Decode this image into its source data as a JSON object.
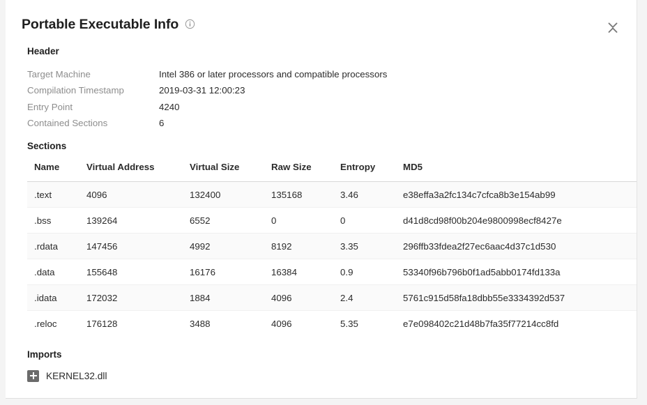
{
  "panel": {
    "title": "Portable Executable Info",
    "info_icon": "info-circle-icon",
    "collapse_icon": "collapse-expand-chevrons-icon"
  },
  "header": {
    "heading": "Header",
    "rows": [
      {
        "label": "Target Machine",
        "value": "Intel 386 or later processors and compatible processors"
      },
      {
        "label": "Compilation Timestamp",
        "value": "2019-03-31 12:00:23"
      },
      {
        "label": "Entry Point",
        "value": "4240"
      },
      {
        "label": "Contained Sections",
        "value": "6"
      }
    ]
  },
  "sections": {
    "heading": "Sections",
    "columns": [
      "Name",
      "Virtual Address",
      "Virtual Size",
      "Raw Size",
      "Entropy",
      "MD5"
    ],
    "rows": [
      {
        "name": ".text",
        "virtual_address": "4096",
        "virtual_size": "132400",
        "raw_size": "135168",
        "entropy": "3.46",
        "md5": "e38effa3a2fc134c7cfca8b3e154ab99"
      },
      {
        "name": ".bss",
        "virtual_address": "139264",
        "virtual_size": "6552",
        "raw_size": "0",
        "entropy": "0",
        "md5": "d41d8cd98f00b204e9800998ecf8427e"
      },
      {
        "name": ".rdata",
        "virtual_address": "147456",
        "virtual_size": "4992",
        "raw_size": "8192",
        "entropy": "3.35",
        "md5": "296ffb33fdea2f27ec6aac4d37c1d530"
      },
      {
        "name": ".data",
        "virtual_address": "155648",
        "virtual_size": "16176",
        "raw_size": "16384",
        "entropy": "0.9",
        "md5": "53340f96b796b0f1ad5abb0174fd133a"
      },
      {
        "name": ".idata",
        "virtual_address": "172032",
        "virtual_size": "1884",
        "raw_size": "4096",
        "entropy": "2.4",
        "md5": "5761c915d58fa18dbb55e3334392d537"
      },
      {
        "name": ".reloc",
        "virtual_address": "176128",
        "virtual_size": "3488",
        "raw_size": "4096",
        "entropy": "5.35",
        "md5": "e7e098402c21d48b7fa35f77214cc8fd"
      }
    ]
  },
  "imports": {
    "heading": "Imports",
    "items": [
      {
        "name": "KERNEL32.dll",
        "expander_icon": "plus-square-icon"
      }
    ]
  },
  "colors": {
    "page_background": "#f4f4f4",
    "card_background": "#ffffff",
    "title_text": "#1f1f1f",
    "label_text": "#8d8d8d",
    "value_text": "#2b2b2b",
    "row_alt_background": "#fafafa",
    "header_rule": "#d8d8d8",
    "expander_background": "#6b6b6b"
  }
}
